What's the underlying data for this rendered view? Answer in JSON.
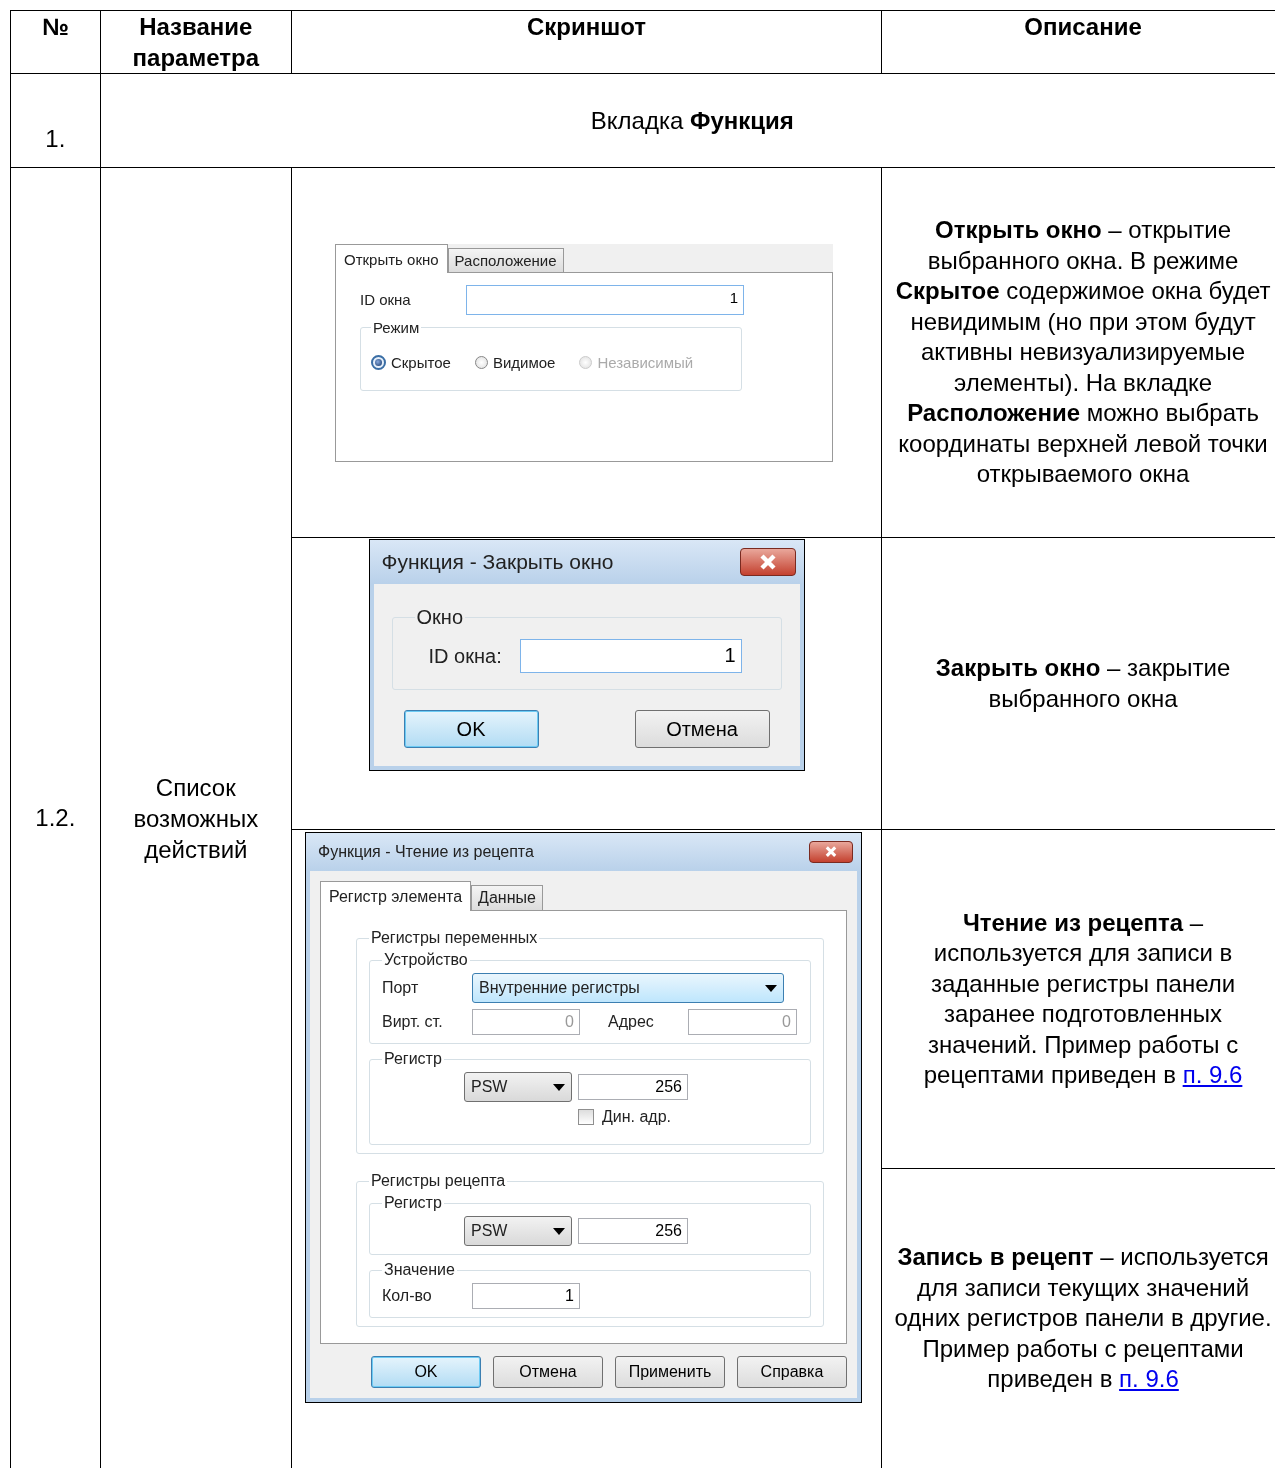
{
  "table": {
    "columns": [
      "№",
      "Название параметра",
      "Скриншот",
      "Описание"
    ],
    "section": {
      "number": "1.",
      "title": "Вкладка **Функция**"
    },
    "group": {
      "number": "1.2.",
      "name": "Список возможных действий"
    },
    "open_window_panel": {
      "tabs": [
        {
          "label": "Открыть окно",
          "selected": true
        },
        {
          "label": "Расположение",
          "selected": false
        }
      ],
      "id_label": "ID окна",
      "id_value": "1",
      "mode_legend": "Режим",
      "modes": [
        {
          "label": "Скрытое",
          "selected": true,
          "disabled": false
        },
        {
          "label": "Видимое",
          "selected": false,
          "disabled": false
        },
        {
          "label": "Независимый",
          "selected": false,
          "disabled": true
        }
      ]
    },
    "close_window_dialog": {
      "title": "Функция - Закрыть окно",
      "group_legend": "Окно",
      "id_label": "ID окна:",
      "id_value": "1",
      "buttons": [
        {
          "label": "OK",
          "default": true
        },
        {
          "label": "Отмена",
          "default": false
        }
      ]
    },
    "recipe_dialog": {
      "title": "Функция - Чтение из рецепта",
      "tabs": [
        {
          "label": "Регистр элемента",
          "selected": true
        },
        {
          "label": "Данные",
          "selected": false
        }
      ],
      "variable_registers": {
        "legend": "Регистры переменных",
        "device": {
          "legend": "Устройство",
          "port_label": "Порт",
          "port_value": "Внутренние регистры",
          "station_label": "Вирт. ст.",
          "station_value": "0",
          "station_disabled": true,
          "address_label": "Адрес",
          "address_value": "0",
          "address_disabled": true
        },
        "register": {
          "legend": "Регистр",
          "type": "PSW",
          "number": "256",
          "dynamic_label": "Дин. адр.",
          "dynamic_checked": false
        }
      },
      "recipe_registers": {
        "legend": "Регистры рецепта",
        "register": {
          "legend": "Регистр",
          "type": "PSW",
          "number": "256"
        },
        "value": {
          "legend": "Значение",
          "count_label": "Кол-во",
          "count_value": "1"
        }
      },
      "buttons": [
        {
          "label": "OK",
          "default": true
        },
        {
          "label": "Отмена",
          "default": false
        },
        {
          "label": "Применить",
          "default": false
        },
        {
          "label": "Справка",
          "default": false
        }
      ]
    },
    "descriptions": [
      {
        "text": "**Открыть окно** – открытие выбранного окна. В режиме **Скрытое** содержимое окна будет невидимым (но при этом будут активны невизуализируемые элементы). На вкладке **Расположение** можно выбрать координаты верхней левой точки открываемого окна"
      },
      {
        "text": "**Закрыть окно** – закрытие выбранного окна"
      },
      {
        "text": "**Чтение из рецепта** – используется для записи в заданные регистры панели заранее подготовленных значений. Пример работы с рецептами приведен в",
        "link": "п. 9.6"
      },
      {
        "text": "**Запись в рецепт** – используется для записи текущих значений одних регистров панели в другие. Пример работы с рецептами приведен в",
        "link": "п. 9.6"
      }
    ]
  }
}
